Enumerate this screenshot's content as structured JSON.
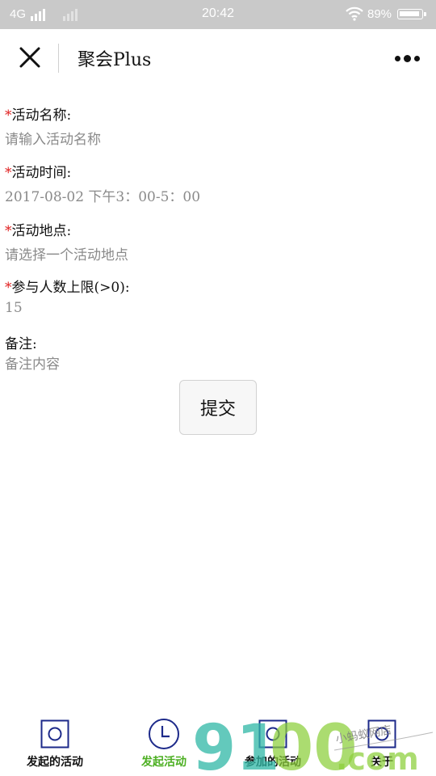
{
  "status_bar": {
    "network": "4G",
    "time": "20:42",
    "battery_pct": "89%"
  },
  "nav": {
    "title": "聚会Plus"
  },
  "form": {
    "fields": [
      {
        "required": "*",
        "label": "活动名称:",
        "value": "请输入活动名称"
      },
      {
        "required": "*",
        "label": "活动时间:",
        "value": "2017-08-02 下午3：00-5：00"
      },
      {
        "required": "*",
        "label": "活动地点:",
        "value": "请选择一个活动地点"
      },
      {
        "required": "*",
        "label": "参与人数上限(>0):",
        "value": "15"
      },
      {
        "required": "",
        "label": "备注:",
        "value": "备注内容"
      }
    ],
    "submit_label": "提交"
  },
  "tabbar": {
    "items": [
      {
        "label": "发起的活动",
        "icon": "square-circle-icon"
      },
      {
        "label": "发起活动",
        "icon": "clock-icon",
        "active": true
      },
      {
        "label": "参加的活动",
        "icon": "square-circle-icon"
      },
      {
        "label": "关于",
        "icon": "square-circle-icon"
      }
    ],
    "active_color": "#4caf22"
  },
  "watermark": {
    "text": "9100.com",
    "subtext": "小蚂蚁网店"
  }
}
